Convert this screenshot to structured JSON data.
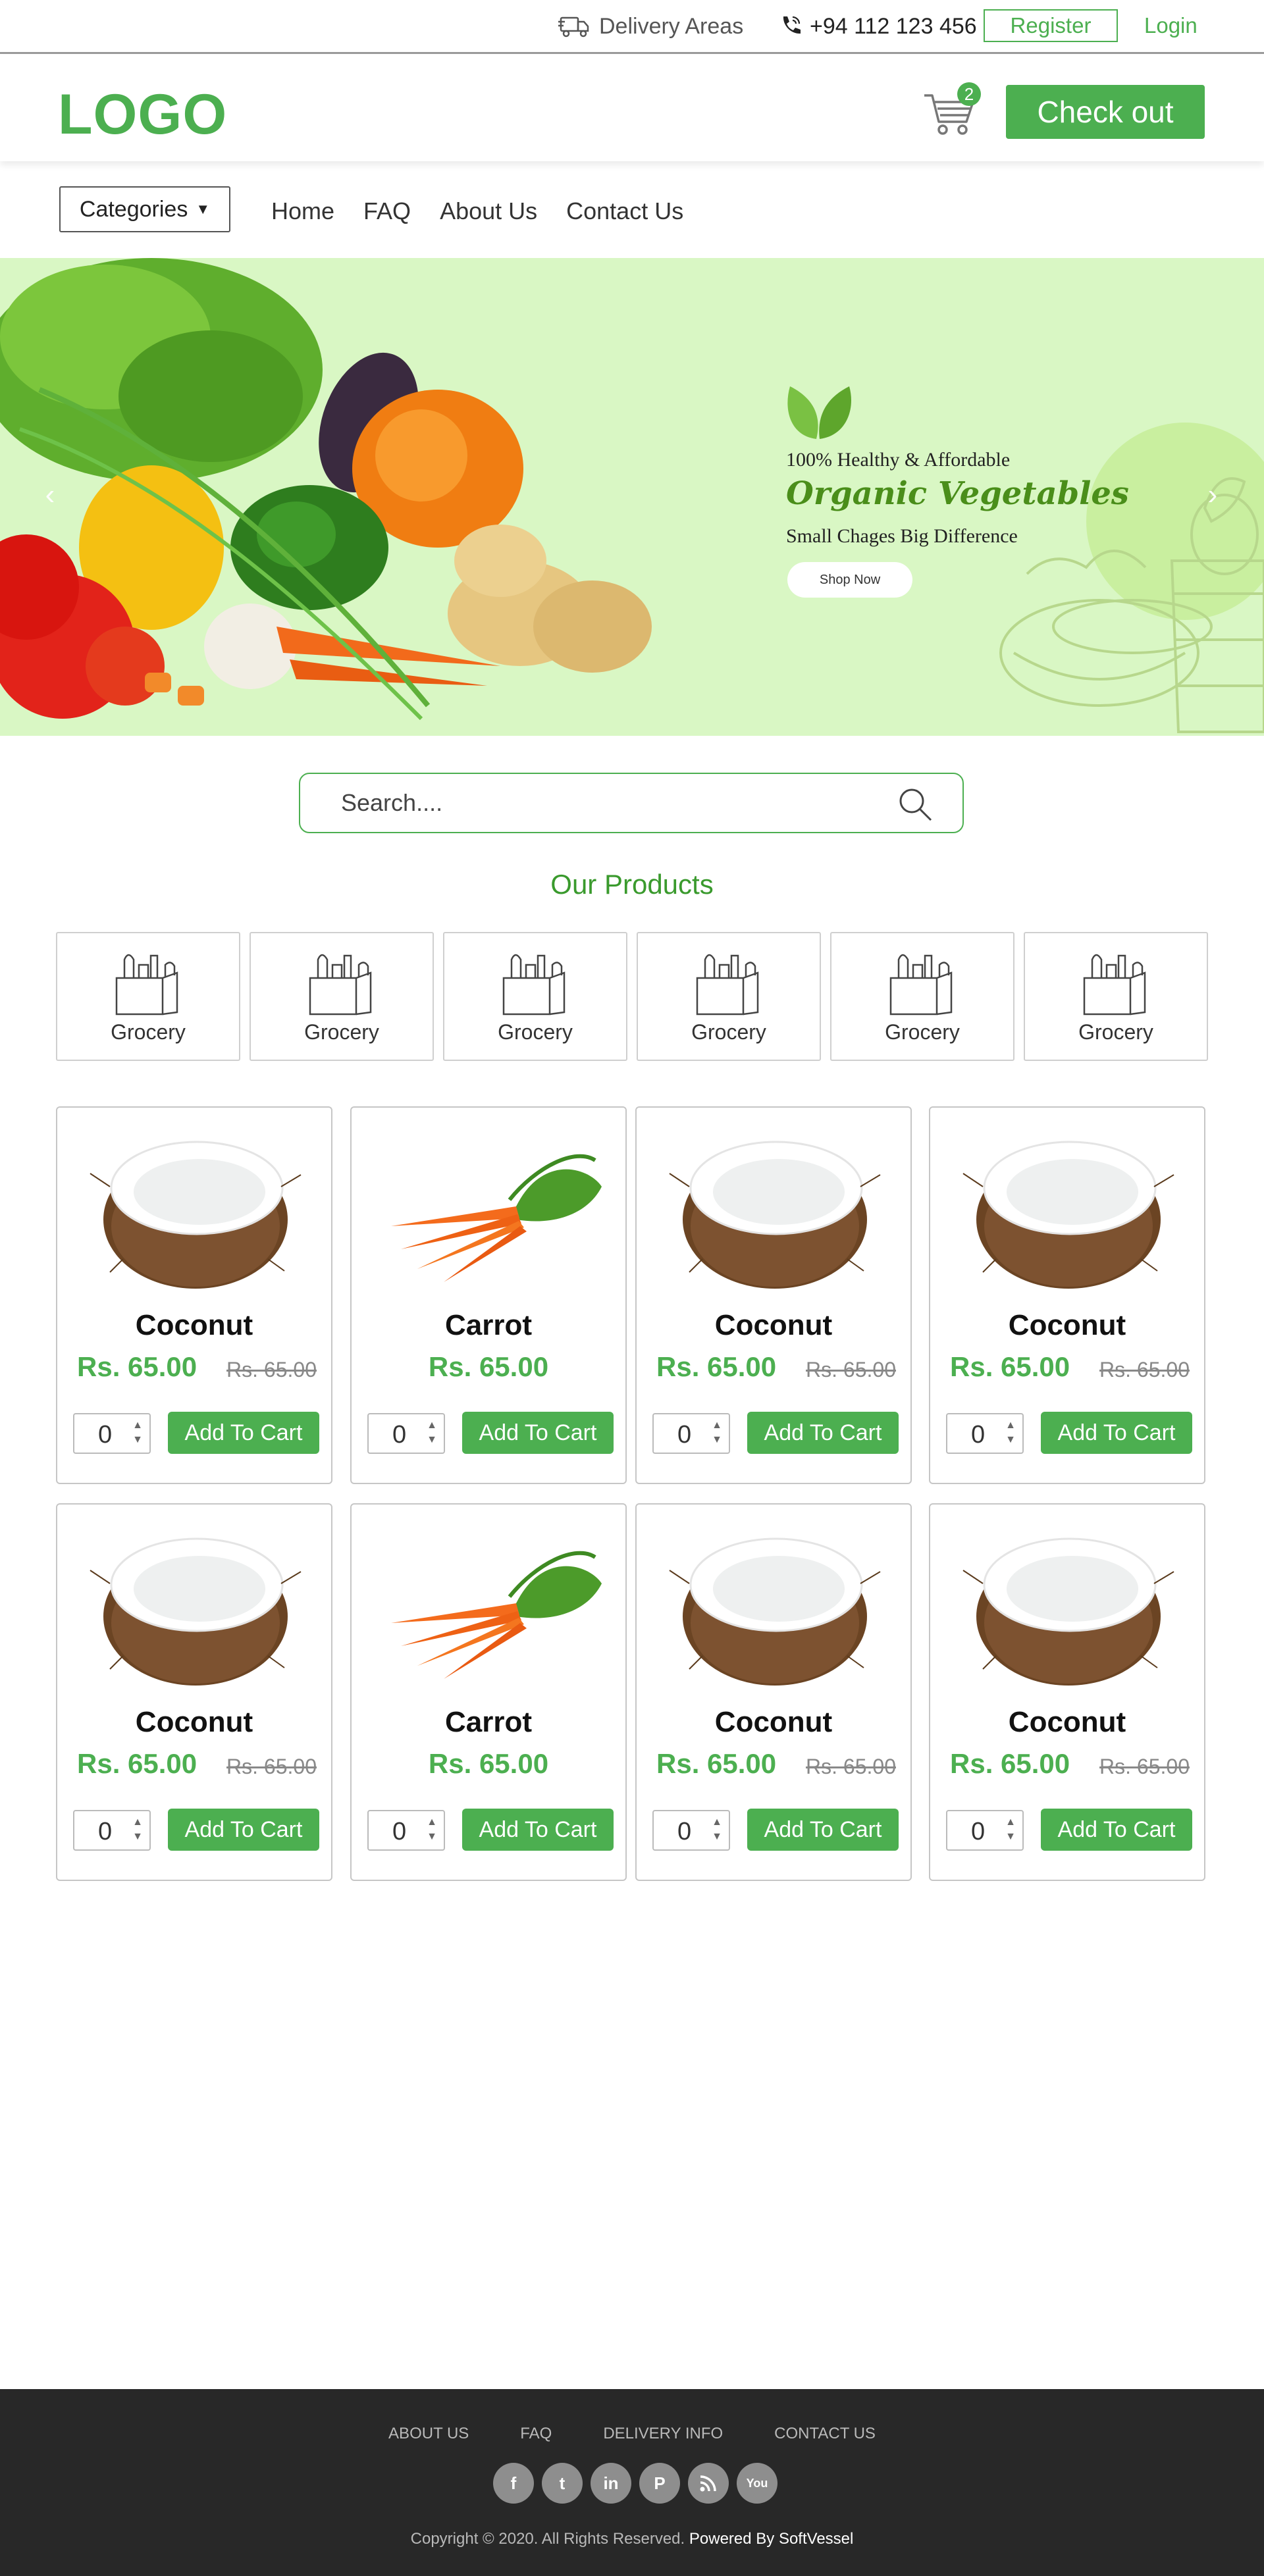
{
  "topbar": {
    "delivery_label": "Delivery Areas",
    "phone": "+94 112 123 456",
    "register_label": "Register",
    "login_label": "Login"
  },
  "header": {
    "logo": "LOGO",
    "cart_count": "2",
    "checkout_label": "Check out"
  },
  "nav": {
    "categories_label": "Categories",
    "links": [
      "Home",
      "FAQ",
      "About Us",
      "Contact Us"
    ]
  },
  "hero": {
    "subtitle": "100% Healthy & Affordable",
    "title": "Organic Vegetables",
    "tagline": "Small Chages Big Difference",
    "button_label": "Shop Now"
  },
  "search": {
    "placeholder": "Search...."
  },
  "products_section": {
    "title": "Our Products",
    "categories": [
      "Grocery",
      "Grocery",
      "Grocery",
      "Grocery",
      "Grocery",
      "Grocery"
    ],
    "items": [
      {
        "name": "Coconut",
        "price": "Rs. 65.00",
        "old_price": "Rs. 65.00",
        "qty": "0",
        "button": "Add To Cart",
        "image": "coconut"
      },
      {
        "name": "Carrot",
        "price": "Rs. 65.00",
        "old_price": "",
        "qty": "0",
        "button": "Add To Cart",
        "image": "carrot"
      },
      {
        "name": "Coconut",
        "price": "Rs. 65.00",
        "old_price": "Rs. 65.00",
        "qty": "0",
        "button": "Add To Cart",
        "image": "coconut"
      },
      {
        "name": "Coconut",
        "price": "Rs. 65.00",
        "old_price": "Rs. 65.00",
        "qty": "0",
        "button": "Add To Cart",
        "image": "coconut"
      },
      {
        "name": "Coconut",
        "price": "Rs. 65.00",
        "old_price": "Rs. 65.00",
        "qty": "0",
        "button": "Add To Cart",
        "image": "coconut"
      },
      {
        "name": "Carrot",
        "price": "Rs. 65.00",
        "old_price": "",
        "qty": "0",
        "button": "Add To Cart",
        "image": "carrot"
      },
      {
        "name": "Coconut",
        "price": "Rs. 65.00",
        "old_price": "Rs. 65.00",
        "qty": "0",
        "button": "Add To Cart",
        "image": "coconut"
      },
      {
        "name": "Coconut",
        "price": "Rs. 65.00",
        "old_price": "Rs. 65.00",
        "qty": "0",
        "button": "Add To Cart",
        "image": "coconut"
      }
    ]
  },
  "footer": {
    "links": [
      "ABOUT US",
      "FAQ",
      "DELIVERY INFO",
      "CONTACT US"
    ],
    "socials": [
      "facebook-icon",
      "twitter-icon",
      "linkedin-icon",
      "pinterest-icon",
      "rss-icon",
      "youtube-icon"
    ],
    "copyright": "Copyright © 2020. All Rights Reserved.",
    "powered_by": "Powered By SoftVessel"
  },
  "colors": {
    "brand": "#4caf50",
    "hero_bg": "#d9f7c4",
    "footer_bg": "#282828"
  }
}
